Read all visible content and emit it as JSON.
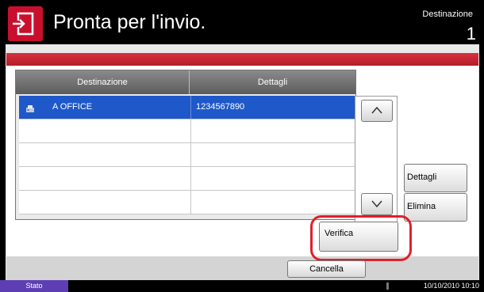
{
  "header": {
    "title": "Pronta per l'invio.",
    "destination_label": "Destinazione",
    "destination_count": "1",
    "icon": "send-icon"
  },
  "table": {
    "columns": [
      "Destinazione",
      "Dettagli"
    ],
    "rows": [
      {
        "destination": "A OFFICE",
        "details": "1234567890",
        "selected": true,
        "icon": "fax-icon"
      },
      {
        "destination": "",
        "details": "",
        "selected": false
      },
      {
        "destination": "",
        "details": "",
        "selected": false
      },
      {
        "destination": "",
        "details": "",
        "selected": false
      },
      {
        "destination": "",
        "details": "",
        "selected": false
      }
    ]
  },
  "scroll": {
    "up_icon": "chevron-up-icon",
    "down_icon": "chevron-down-icon"
  },
  "buttons": {
    "details": "Dettagli",
    "delete": "Elimina",
    "verify": "Verifica",
    "cancel": "Cancella"
  },
  "status": {
    "tab": "Stato",
    "datetime": "10/10/2010  10:10"
  },
  "colors": {
    "accent_red": "#c8102e",
    "selection_blue": "#1e58c9",
    "status_purple": "#5e3fb3"
  }
}
